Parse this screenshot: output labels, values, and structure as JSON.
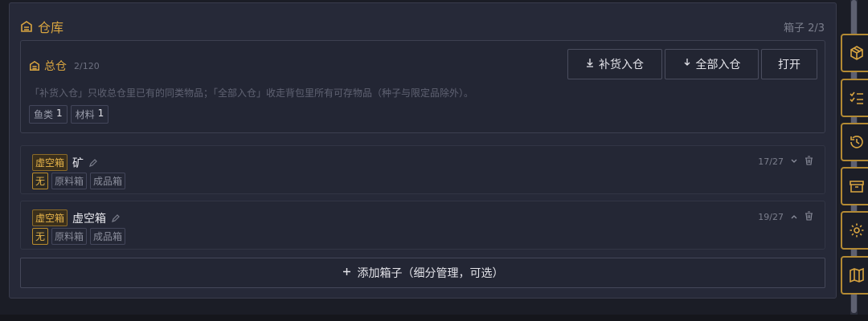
{
  "colors": {
    "accent": "#d9a540",
    "panel_bg": "#262938",
    "page_bg": "#1b1d26",
    "border": "#393c4c"
  },
  "warehouse": {
    "title": "仓库",
    "box_count": "箱子 2/3",
    "title_icon": "warehouse-icon"
  },
  "master": {
    "title": "总仓",
    "capacity": "2/120",
    "description": "「补货入仓」只收总仓里已有的同类物品；「全部入仓」收走背包里所有可存物品（种子与限定品除外）。",
    "buttons": {
      "restock": "补货入仓",
      "store_all": "全部入仓",
      "open": "打开"
    },
    "chips": [
      {
        "label": "鱼类",
        "count": "1"
      },
      {
        "label": "材料",
        "count": "1"
      }
    ]
  },
  "boxes": [
    {
      "tag": "虚空箱",
      "name": "矿",
      "count": "17/27",
      "toggle_icon": "chevron-down-icon",
      "options": [
        "无",
        "原料箱",
        "成品箱"
      ],
      "active_option": "无"
    },
    {
      "tag": "虚空箱",
      "name": "虚空箱",
      "count": "19/27",
      "toggle_icon": "chevron-up-icon",
      "options": [
        "无",
        "原料箱",
        "成品箱"
      ],
      "active_option": "无"
    }
  ],
  "add_box": {
    "label": "添加箱子（细分管理，可选）"
  },
  "rail_icons": [
    "box-icon",
    "checklist-icon",
    "history-icon",
    "archive-icon",
    "gear-icon",
    "map-icon"
  ]
}
